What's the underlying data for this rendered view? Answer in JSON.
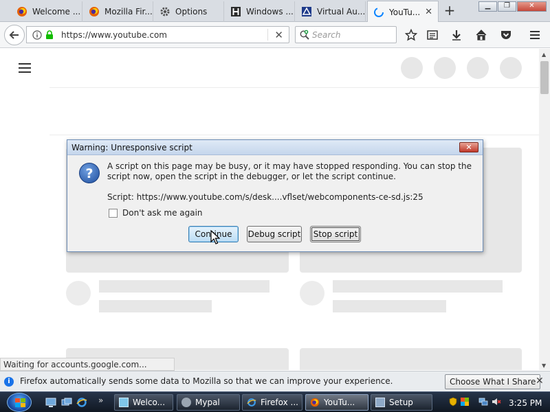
{
  "browser": {
    "tabs": [
      {
        "label": "Welcome ...",
        "icon": "firefox-icon"
      },
      {
        "label": "Mozilla Fir...",
        "icon": "firefox-icon"
      },
      {
        "label": "Options",
        "icon": "gear-icon"
      },
      {
        "label": "Windows ...",
        "icon": "hh-icon"
      },
      {
        "label": "Virtual Au...",
        "icon": "virtual-icon"
      },
      {
        "label": "YouTu...",
        "icon": "loading-icon",
        "active": true
      }
    ],
    "url": "https://www.youtube.com",
    "search_placeholder": "Search"
  },
  "dialog": {
    "title": "Warning: Unresponsive script",
    "message": "A script on this page may be busy, or it may have stopped responding. You can stop the script now, open the script in the debugger, or let the script continue.",
    "script_line": "Script: https://www.youtube.com/s/desk....vflset/webcomponents-ce-sd.js:25",
    "checkbox_label": "Don't ask me again",
    "checkbox_checked": false,
    "buttons": {
      "continue": "Continue",
      "debug": "Debug script",
      "stop": "Stop script"
    }
  },
  "status": {
    "text": "Waiting for accounts.google.com..."
  },
  "notification": {
    "text": "Firefox automatically sends some data to Mozilla so that we can improve your experience.",
    "button": "Choose What I Share"
  },
  "taskbar": {
    "tasks": [
      {
        "label": "Welco..."
      },
      {
        "label": "Mypal"
      },
      {
        "label": "Firefox ..."
      },
      {
        "label": "YouTu...",
        "active": true
      },
      {
        "label": "Setup"
      }
    ],
    "clock": "3:25 PM"
  },
  "colors": {
    "accent": "#1a73e8",
    "skeleton": "#e7e7e7",
    "taskbar": "#1b2636"
  }
}
